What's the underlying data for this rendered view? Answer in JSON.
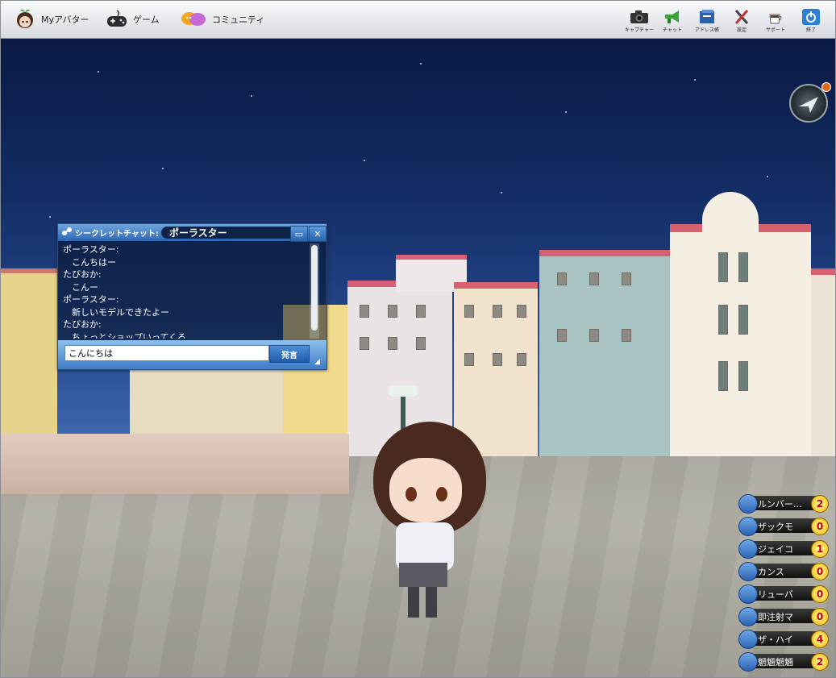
{
  "nav": {
    "my_avatar": "Myアバター",
    "game": "ゲーム",
    "community": "コミュニティ"
  },
  "toolbar": {
    "capture": "キャプチャー",
    "chat": "チャット",
    "address_book": "アドレス帳",
    "settings": "設定",
    "support": "サポート",
    "exit": "終了"
  },
  "chat": {
    "title": "シークレットチャット:",
    "partner": "ポーラスター",
    "messages": [
      "ポーラスター:",
      "　こんちはー",
      "たびおか:",
      "　こんー",
      "ポーラスター:",
      "　新しいモデルできたよー",
      "たびおか:",
      "　ちょっとショップいってくる"
    ],
    "input_value": "こんにちは",
    "send_label": "発言"
  },
  "friends": [
    {
      "name": "ルンバー…",
      "count": "2"
    },
    {
      "name": "ザックモ",
      "count": "0"
    },
    {
      "name": "ジェイコ",
      "count": "1"
    },
    {
      "name": "カンス",
      "count": "0"
    },
    {
      "name": "リューバ",
      "count": "0"
    },
    {
      "name": "即注射マ",
      "count": "0"
    },
    {
      "name": "ザ・ハイ",
      "count": "4"
    },
    {
      "name": "魍魎魍魎",
      "count": "2"
    }
  ]
}
